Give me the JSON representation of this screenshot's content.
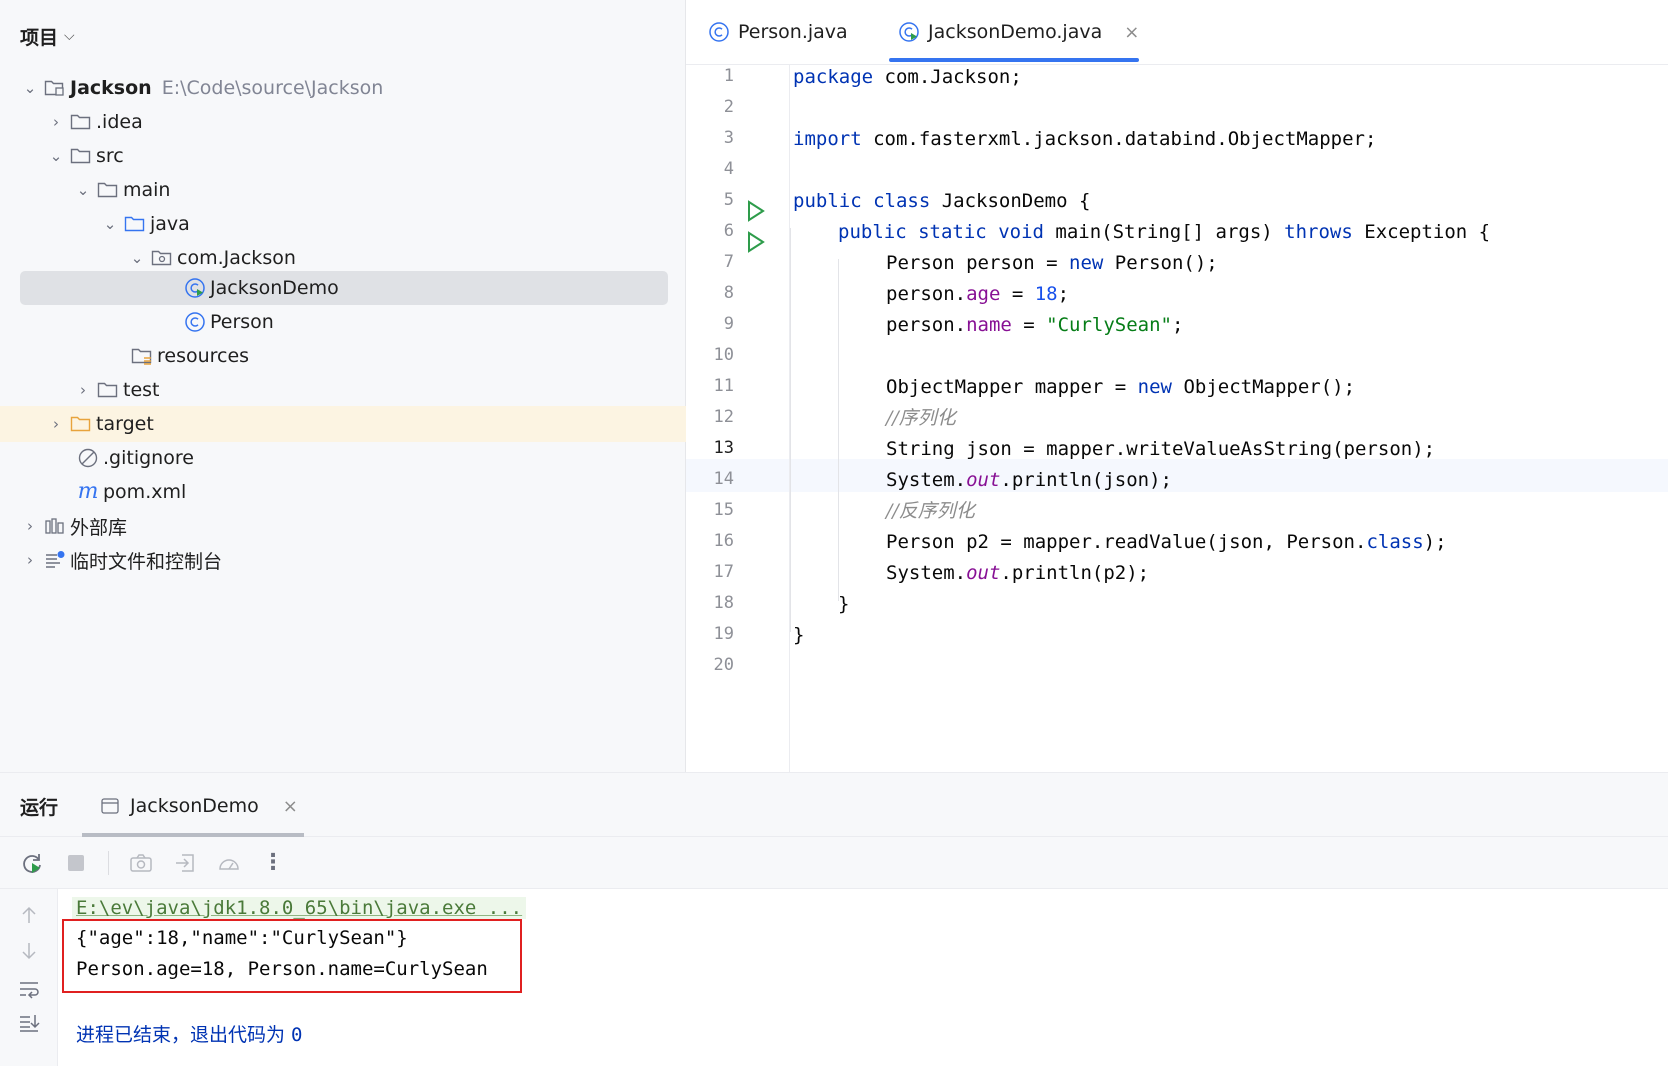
{
  "project": {
    "header": "项目",
    "tree": [
      {
        "label": "Jackson",
        "path": "E:\\Code\\source\\Jackson",
        "icon": "module-folder-icon"
      },
      {
        "label": ".idea",
        "icon": "folder-icon"
      },
      {
        "label": "src",
        "icon": "folder-icon"
      },
      {
        "label": "main",
        "icon": "folder-icon"
      },
      {
        "label": "java",
        "icon": "source-folder-icon"
      },
      {
        "label": "com.Jackson",
        "icon": "package-icon"
      },
      {
        "label": "JacksonDemo",
        "icon": "runnable-class-icon"
      },
      {
        "label": "Person",
        "icon": "class-icon"
      },
      {
        "label": "resources",
        "icon": "resources-folder-icon"
      },
      {
        "label": "test",
        "icon": "folder-icon"
      },
      {
        "label": "target",
        "icon": "excluded-folder-icon"
      },
      {
        "label": ".gitignore",
        "icon": "ignore-file-icon"
      },
      {
        "label": "pom.xml",
        "icon": "maven-icon"
      },
      {
        "label": "外部库",
        "icon": "library-icon"
      },
      {
        "label": "临时文件和控制台",
        "icon": "scratches-icon"
      }
    ]
  },
  "editor": {
    "tabs": [
      {
        "label": "Person.java",
        "icon": "class-icon"
      },
      {
        "label": "JacksonDemo.java",
        "icon": "runnable-class-icon",
        "close": "×"
      }
    ],
    "line_numbers": [
      "1",
      "2",
      "3",
      "4",
      "5",
      "6",
      "7",
      "8",
      "9",
      "10",
      "11",
      "12",
      "13",
      "14",
      "15",
      "16",
      "17",
      "18",
      "19",
      "20"
    ],
    "current_line": "13",
    "code": {
      "l1_kw": "package",
      "l1_rest": " com.Jackson;",
      "l3_kw": "import",
      "l3_rest": " com.fasterxml.jackson.databind.ObjectMapper;",
      "l5_kw1": "public",
      "l5_kw2": "class",
      "l5_rest": " JacksonDemo {",
      "l6_kw1": "public",
      "l6_kw2": "static",
      "l6_kw3": "void",
      "l6_mid": " main(String[] args) ",
      "l6_kw4": "throws",
      "l6_rest": " Exception {",
      "l7_a": "Person person = ",
      "l7_kw": "new",
      "l7_b": " Person();",
      "l8_a": "person.",
      "l8_fld": "age",
      "l8_b": " = ",
      "l8_num": "18",
      "l8_c": ";",
      "l9_a": "person.",
      "l9_fld": "name",
      "l9_b": " = ",
      "l9_str": "\"CurlySean\"",
      "l9_c": ";",
      "l11_a": "ObjectMapper mapper = ",
      "l11_kw": "new",
      "l11_b": " ObjectMapper();",
      "l12_cmt": "//序列化",
      "l13": "String json = mapper.writeValueAsString(person);",
      "l14_a": "System.",
      "l14_it": "out",
      "l14_b": ".println(json);",
      "l15_cmt": "//反序列化",
      "l16_a": "Person p2 = mapper.readValue(json, Person.",
      "l16_kw": "class",
      "l16_b": ");",
      "l17_a": "System.",
      "l17_it": "out",
      "l17_b": ".println(p2);",
      "l18": "}",
      "l19": "}"
    }
  },
  "run": {
    "title": "运行",
    "tab_label": "JacksonDemo",
    "tab_close": "×",
    "console": {
      "command": "E:\\ev\\java\\jdk1.8.0_65\\bin\\java.exe ...",
      "output1": "{\"age\":18,\"name\":\"CurlySean\"}",
      "output2": "Person.age=18, Person.name=CurlySean",
      "exit_text": "进程已结束，退出代码为 ",
      "exit_code": "0"
    }
  },
  "colors": {
    "accent": "#3574f0",
    "keyword": "#0033b3",
    "string": "#067d17",
    "field": "#871094",
    "highlight_box": "#e02020"
  }
}
